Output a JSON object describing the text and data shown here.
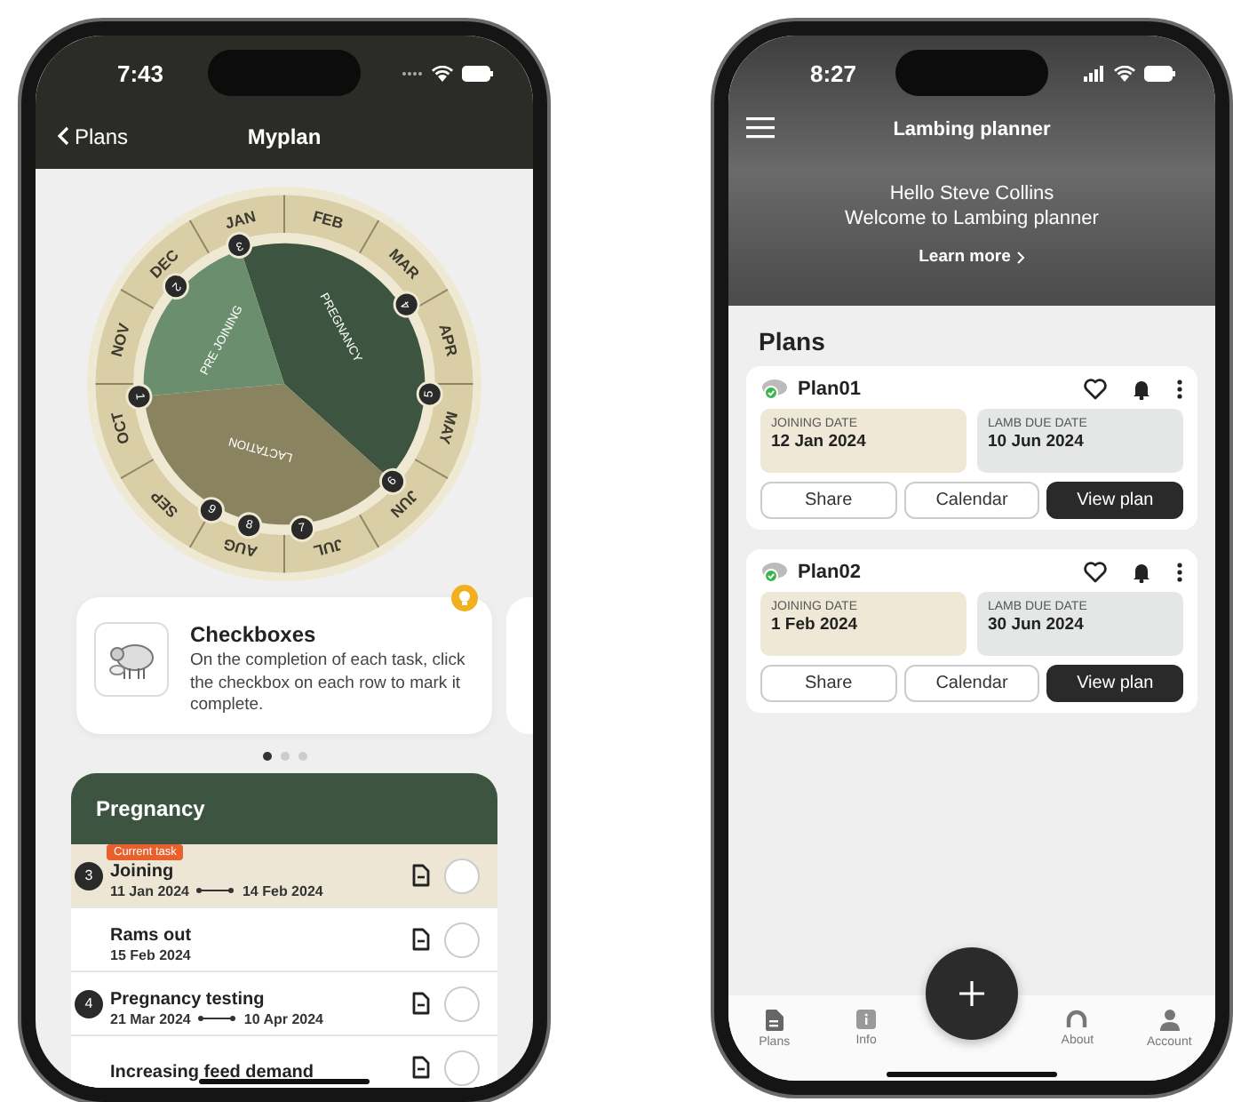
{
  "myplan": {
    "status_time": "7:43",
    "back_label": "Plans",
    "title": "Myplan",
    "wheel": {
      "months": [
        "JAN",
        "FEB",
        "MAR",
        "APR",
        "MAY",
        "JUN",
        "JUL",
        "AUG",
        "SEP",
        "OCT",
        "NOV",
        "DEC"
      ],
      "phases": [
        {
          "label": "PREGNANCY",
          "color": "#3d5540"
        },
        {
          "label": "LACTATION",
          "color": "#8a8360"
        },
        {
          "label": "PRE JOINING",
          "color": "#6b8e6e"
        }
      ],
      "markers": [
        "1",
        "2",
        "3",
        "4",
        "5",
        "6",
        "7",
        "8",
        "9"
      ]
    },
    "tip": {
      "title": "Checkboxes",
      "text": "On the completion of each task, click the checkbox on each row to mark it complete."
    },
    "carousel_dots": [
      {
        "selected": true
      },
      {
        "selected": false
      },
      {
        "selected": false
      }
    ],
    "section": {
      "title": "Pregnancy",
      "tasks": [
        {
          "step": "3",
          "badge": "Current task",
          "title": "Joining",
          "start": "11 Jan 2024",
          "end": "14 Feb 2024",
          "current": true,
          "checked": false
        },
        {
          "title": "Rams out",
          "start": "15 Feb 2024",
          "current": false,
          "checked": false
        },
        {
          "step": "4",
          "title": "Pregnancy testing",
          "start": "21 Mar 2024",
          "end": "10 Apr 2024",
          "current": false,
          "checked": false
        },
        {
          "title": "Increasing feed demand",
          "current": false,
          "checked": false
        }
      ]
    }
  },
  "planner": {
    "status_time": "8:27",
    "title": "Lambing planner",
    "greeting": "Hello Steve Collins",
    "welcome": "Welcome to Lambing planner",
    "learn_more": "Learn more",
    "plans_heading": "Plans",
    "plans": [
      {
        "name": "Plan01",
        "joining_label": "JOINING DATE",
        "joining_date": "12 Jan 2024",
        "due_label": "LAMB DUE DATE",
        "due_date": "10 Jun 2024",
        "buttons": [
          "Share",
          "Calendar",
          "View plan"
        ]
      },
      {
        "name": "Plan02",
        "joining_label": "JOINING DATE",
        "joining_date": "1 Feb 2024",
        "due_label": "LAMB DUE DATE",
        "due_date": "30 Jun 2024",
        "buttons": [
          "Share",
          "Calendar",
          "View plan"
        ]
      }
    ],
    "tabs": [
      {
        "kind": "plans",
        "label": "Plans"
      },
      {
        "kind": "info",
        "label": "Info"
      },
      {
        "kind": "about",
        "label": "About"
      },
      {
        "kind": "account",
        "label": "Account"
      }
    ]
  }
}
